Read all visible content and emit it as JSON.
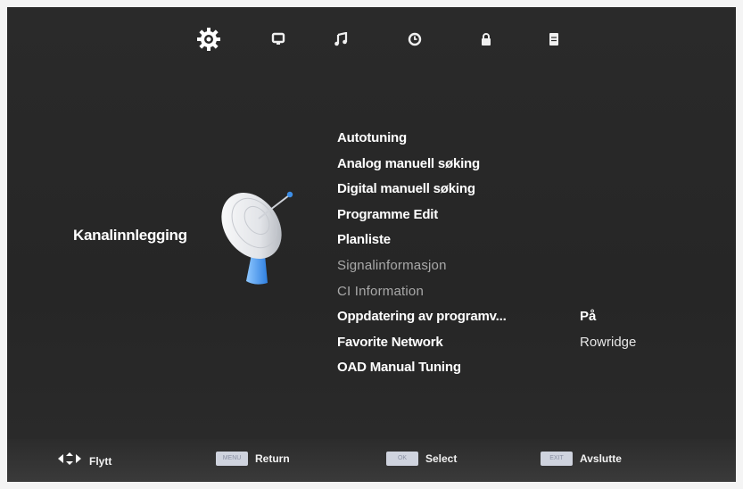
{
  "nav": {
    "icons": [
      "gear-icon",
      "monitor-icon",
      "music-note-icon",
      "clock-icon",
      "lock-icon",
      "document-icon"
    ],
    "active_index": 0,
    "active_color": "#ffffff",
    "inactive_color": "#f0f0f0"
  },
  "section": {
    "title": "Kanalinnlegging",
    "icon": "satellite-dish-icon"
  },
  "menu": {
    "items": [
      {
        "label": "Autotuning",
        "enabled": true
      },
      {
        "label": "Analog manuell søking",
        "enabled": true
      },
      {
        "label": "Digital manuell søking",
        "enabled": true
      },
      {
        "label": "Programme Edit",
        "enabled": true
      },
      {
        "label": "Planliste",
        "enabled": true
      },
      {
        "label": "Signalinformasjon",
        "enabled": false
      },
      {
        "label": "CI Information",
        "enabled": false
      },
      {
        "label": "Oppdatering av programv...",
        "enabled": true,
        "value": "På"
      },
      {
        "label": "Favorite Network",
        "enabled": true,
        "value": "Rowridge"
      },
      {
        "label": "OAD Manual Tuning",
        "enabled": true
      }
    ]
  },
  "footer": {
    "move": {
      "icon": "arrows-move-icon",
      "label": "Flytt"
    },
    "return": {
      "key": "MENU",
      "label": "Return"
    },
    "select": {
      "key": "OK",
      "label": "Select"
    },
    "exit": {
      "key": "EXIT",
      "label": "Avslutte"
    }
  },
  "colors": {
    "background": "#282828",
    "text_enabled": "#ffffff",
    "text_disabled": "#a9a9a9",
    "keycap": "#cfd3de"
  }
}
